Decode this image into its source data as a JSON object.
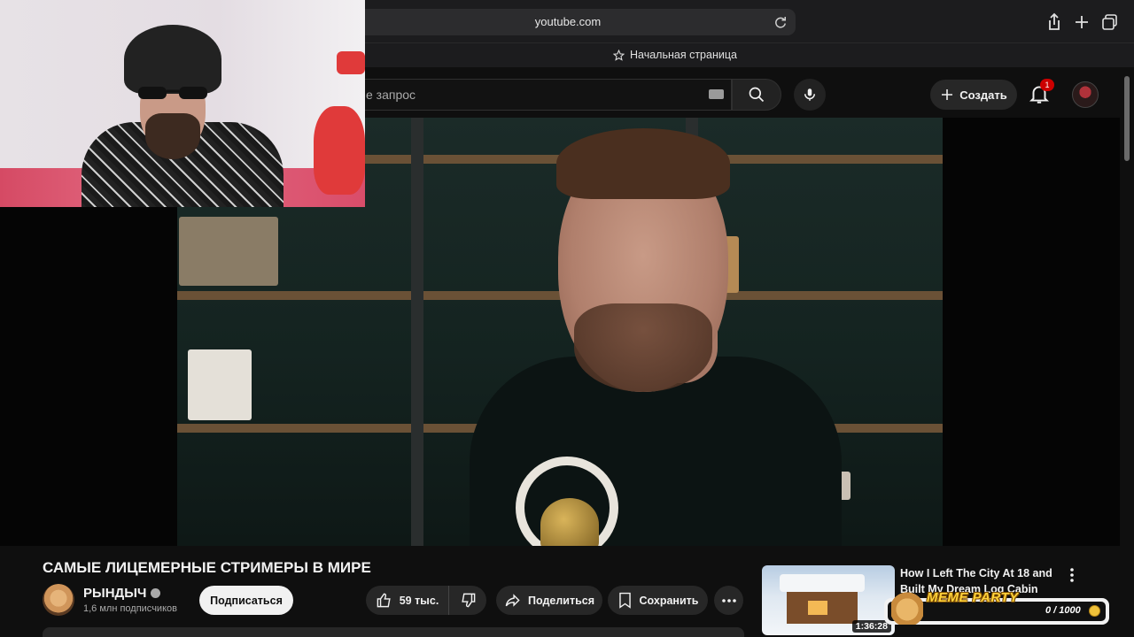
{
  "browser": {
    "url": "youtube.com",
    "favorites_item": "Начальная страница"
  },
  "header": {
    "search_placeholder": "е запрос",
    "create_label": "Создать",
    "notification_count": "1"
  },
  "video": {
    "title": "САМЫЕ ЛИЦЕМЕРНЫЕ СТРИМЕРЫ В МИРЕ",
    "channel_name": "РЫНДЫЧ",
    "subscribers": "1,6 млн подписчиков",
    "subscribe_label": "Подписаться",
    "likes": "59 тыс.",
    "share_label": "Поделиться",
    "save_label": "Сохранить"
  },
  "recommendation": {
    "title": "How I Left The City At 18 and Built My Dream Log Cabin",
    "duration": "1:36:28"
  },
  "meme_widget": {
    "title": "MEME PARTY",
    "counter": "0 / 1000"
  },
  "colors": {
    "background": "#0f0f0f",
    "pill": "#272727",
    "notification": "#cc0000",
    "meme_gold": "#ffd23a"
  }
}
